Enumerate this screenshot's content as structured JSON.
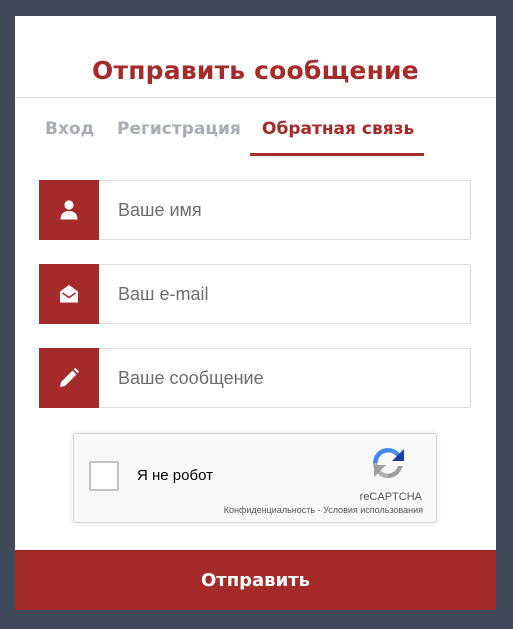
{
  "modal": {
    "title": "Отправить сообщение"
  },
  "tabs": [
    {
      "label": "Вход",
      "active": false
    },
    {
      "label": "Регистрация",
      "active": false
    },
    {
      "label": "Обратная связь",
      "active": true
    }
  ],
  "form": {
    "name_placeholder": "Ваше имя",
    "name_icon": "user-icon",
    "email_placeholder": "Ваш e-mail",
    "email_icon": "envelope-open-icon",
    "message_placeholder": "Ваше сообщение",
    "message_icon": "pencil-icon",
    "submit_label": "Отправить"
  },
  "recaptcha": {
    "checkbox_label": "Я не робот",
    "brand": "reCAPTCHA",
    "privacy_link": "Конфиденциальность",
    "link_separator": "-",
    "terms_link": "Условия использования",
    "checked": false
  },
  "colors": {
    "accent": "#a52a2a",
    "backdrop": "#3f4a5a",
    "tab_inactive": "#a8adb3"
  }
}
